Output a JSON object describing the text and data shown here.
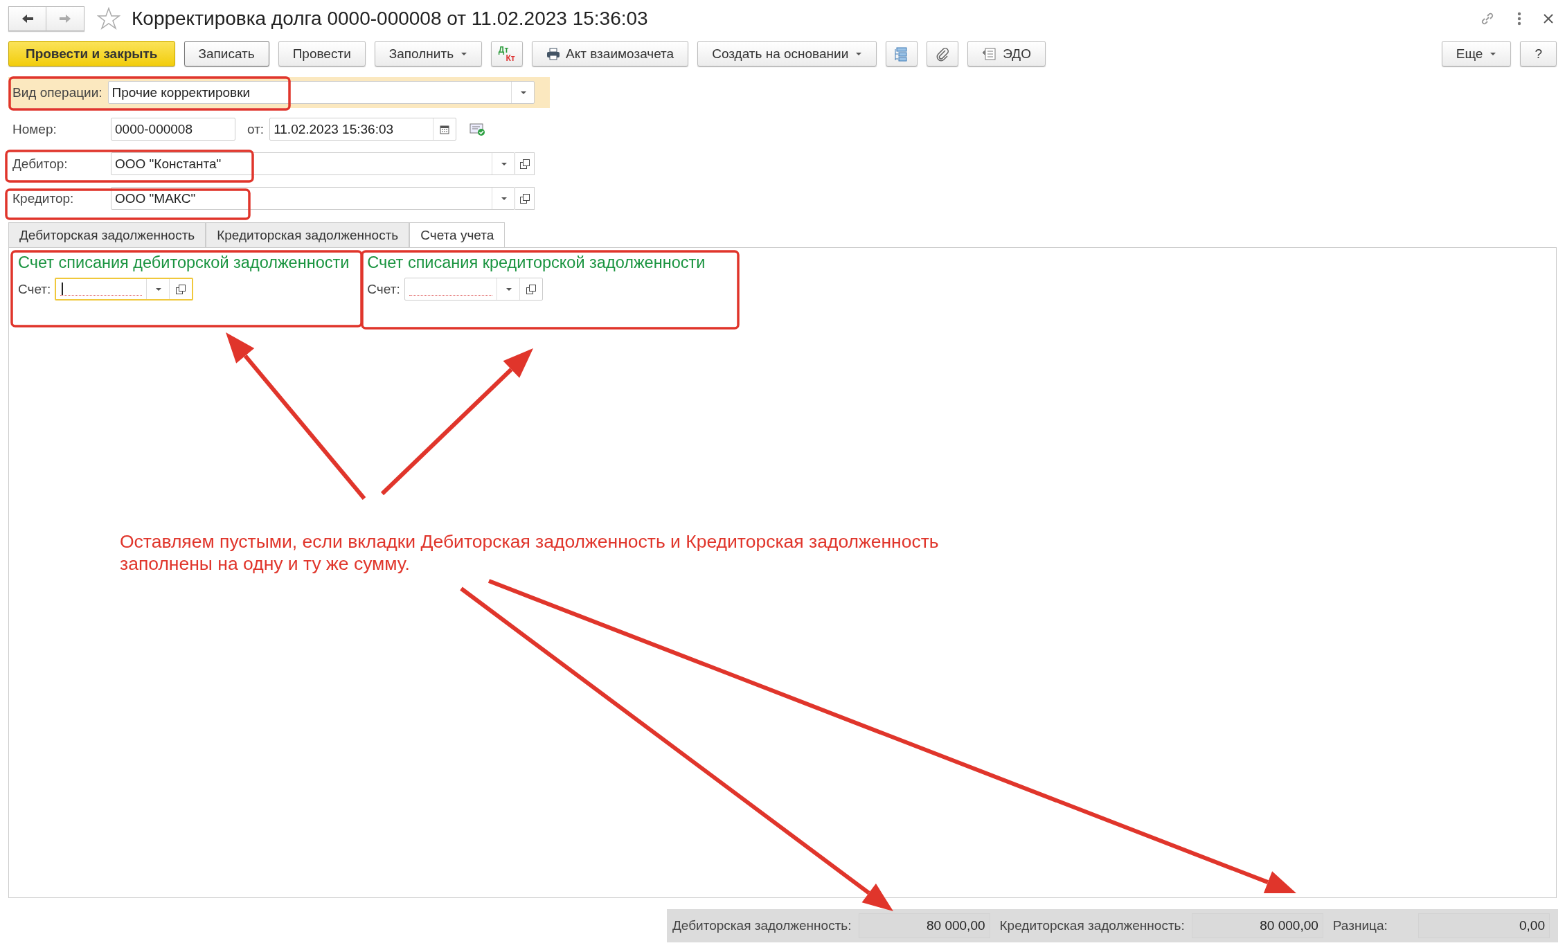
{
  "window": {
    "title": "Корректировка долга 0000-000008 от 11.02.2023 15:36:03",
    "favorite": false
  },
  "toolbar": {
    "buttons": [
      {
        "kind": "primary",
        "label": "Провести и закрыть"
      },
      {
        "kind": "default",
        "label": "Записать"
      },
      {
        "kind": "text",
        "label": "Провести"
      },
      {
        "kind": "dropdown",
        "label": "Заполнить"
      },
      {
        "kind": "dtkt",
        "label_top": "Дт",
        "label_bottom": "Кт"
      },
      {
        "kind": "print",
        "label": "Акт взаимозачета"
      },
      {
        "kind": "dropdown",
        "label": "Создать на основании"
      },
      {
        "kind": "structure"
      },
      {
        "kind": "attach"
      },
      {
        "kind": "edo",
        "label": "ЭДО"
      }
    ],
    "right_buttons": [
      {
        "kind": "dropdown",
        "label": "Еще"
      },
      {
        "kind": "text",
        "label": "?"
      }
    ]
  },
  "operation": {
    "label": "Вид операции:",
    "value": "Прочие корректировки"
  },
  "number": {
    "label": "Номер:",
    "value": "0000-000008"
  },
  "date": {
    "label": "от:",
    "value": "11.02.2023 15:36:03"
  },
  "debtor": {
    "label": "Дебитор:",
    "value": "ООО \"Константа\""
  },
  "creditor": {
    "label": "Кредитор:",
    "value": "ООО \"МАКС\""
  },
  "tabs": [
    {
      "label": "Дебиторская задолженность",
      "selected": false
    },
    {
      "label": "Кредиторская задолженность",
      "selected": false
    },
    {
      "label": "Счета учета",
      "selected": true
    }
  ],
  "groups": [
    {
      "title": "Счет списания дебиторской задолженности",
      "field_label": "Счет:",
      "focused": true
    },
    {
      "title": "Счет списания кредиторской задолженности",
      "field_label": "Счет:",
      "focused": false
    }
  ],
  "annotation": "Оставляем пустыми, если вкладки Дебиторская задолженность и Кредиторская задолженность заполнены на одну и ту же сумму.",
  "footer": [
    {
      "label": "Дебиторская задолженность:",
      "value": "80 000,00"
    },
    {
      "label": "Кредиторская задолженность:",
      "value": "80 000,00"
    },
    {
      "label": "Разница:",
      "value": "0,00"
    }
  ]
}
